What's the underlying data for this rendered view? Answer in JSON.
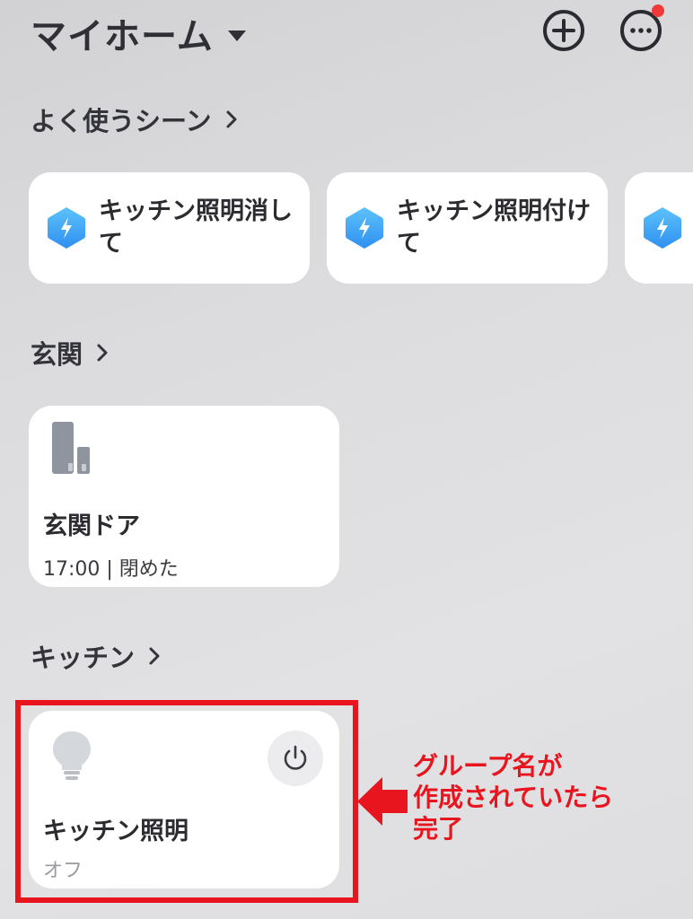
{
  "header": {
    "title": "マイホーム",
    "add_icon": "plus-circle-icon",
    "more_icon": "ellipsis-circle-icon"
  },
  "scenes": {
    "title": "よく使うシーン",
    "icon": "lightning-hexagon-icon",
    "items": [
      {
        "label": "キッチン照明消して"
      },
      {
        "label": "キッチン照明付けて"
      },
      {
        "label": ""
      }
    ]
  },
  "entrance": {
    "title": "玄関",
    "device": {
      "name": "玄関ドア",
      "status": "17:00 | 閉めた",
      "icon": "door-sensor-icon"
    }
  },
  "kitchen": {
    "title": "キッチン",
    "device": {
      "name": "キッチン照明",
      "status": "オフ",
      "icon": "light-bulb-icon",
      "power_icon": "power-icon"
    }
  },
  "annotation": {
    "lines": [
      "グループ名が",
      "作成されていたら",
      "完了"
    ],
    "color": "#e8141e"
  },
  "colors": {
    "accent_blue": "#3aa3f5",
    "notification_red": "#ee3a3a"
  }
}
